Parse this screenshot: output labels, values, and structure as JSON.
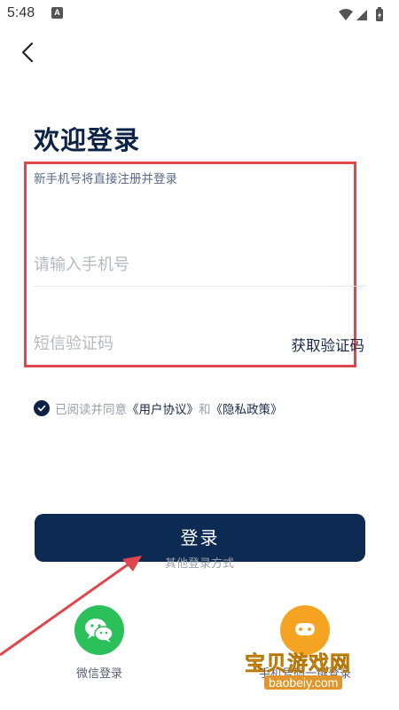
{
  "status_bar": {
    "time": "5:48",
    "notification_badge": "A",
    "icons": [
      "wifi-icon",
      "signal-icon",
      "battery-icon"
    ]
  },
  "header": {
    "back_icon": "chevron-left-icon"
  },
  "title": "欢迎登录",
  "form": {
    "hint": "新手机号将直接注册并登录",
    "phone": {
      "value": "",
      "placeholder": "请输入手机号"
    },
    "code": {
      "value": "",
      "placeholder": "短信验证码"
    },
    "get_code_label": "获取验证码"
  },
  "agreement": {
    "checked": true,
    "prefix": "已阅读并同意",
    "user_agreement": "《用户协议》",
    "and": "和",
    "privacy_policy": "《隐私政策》"
  },
  "login_button": "登录",
  "other_methods": {
    "label": "其他登录方式",
    "wechat": "微信登录",
    "phone": "手机号码一键登录"
  },
  "watermark": {
    "title": "宝贝游戏网",
    "url": "baobeiy.com"
  },
  "colors": {
    "primary": "#0d2b52",
    "annotation_red": "#e0474c",
    "wechat_green": "#2bc05a",
    "phone_orange": "#f5a322"
  }
}
